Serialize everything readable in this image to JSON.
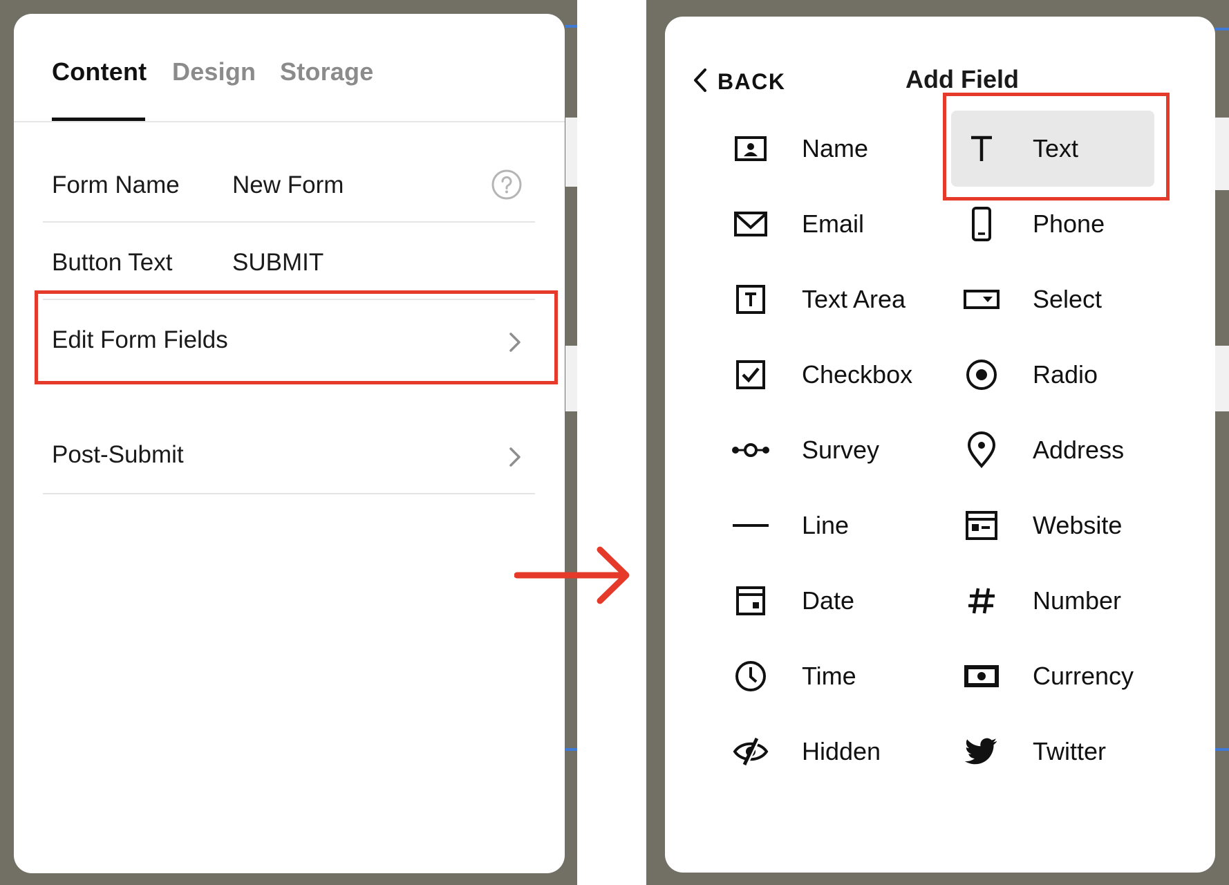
{
  "colors": {
    "olive_background": "#727064",
    "highlight_red": "#e53a2a",
    "arrow_red": "#e53a2a",
    "selected_bg": "#e8e8e8"
  },
  "left_panel": {
    "tabs": [
      {
        "label": "Content",
        "active": true
      },
      {
        "label": "Design",
        "active": false
      },
      {
        "label": "Storage",
        "active": false
      }
    ],
    "form_name": {
      "label": "Form Name",
      "value": "New Form",
      "icon": "help-icon"
    },
    "button_text": {
      "label": "Button Text",
      "value": "SUBMIT"
    },
    "edit_form_fields": {
      "label": "Edit Form Fields",
      "icon": "chevron-right-icon"
    },
    "post_submit": {
      "label": "Post-Submit",
      "icon": "chevron-right-icon"
    }
  },
  "arrow": {
    "icon": "arrow-right-icon"
  },
  "right_panel": {
    "back_label": "BACK",
    "title": "Add Field",
    "fields": [
      {
        "label": "Name",
        "icon": "name-card-icon"
      },
      {
        "label": "Text",
        "icon": "text-t-icon",
        "selected": true
      },
      {
        "label": "Email",
        "icon": "envelope-icon"
      },
      {
        "label": "Phone",
        "icon": "phone-icon"
      },
      {
        "label": "Text Area",
        "icon": "text-area-icon"
      },
      {
        "label": "Select",
        "icon": "select-dropdown-icon"
      },
      {
        "label": "Checkbox",
        "icon": "checkbox-icon"
      },
      {
        "label": "Radio",
        "icon": "radio-icon"
      },
      {
        "label": "Survey",
        "icon": "survey-dots-icon"
      },
      {
        "label": "Address",
        "icon": "map-pin-icon"
      },
      {
        "label": "Line",
        "icon": "line-icon"
      },
      {
        "label": "Website",
        "icon": "website-icon"
      },
      {
        "label": "Date",
        "icon": "calendar-icon"
      },
      {
        "label": "Number",
        "icon": "hash-icon"
      },
      {
        "label": "Time",
        "icon": "clock-icon"
      },
      {
        "label": "Currency",
        "icon": "currency-icon"
      },
      {
        "label": "Hidden",
        "icon": "eye-off-icon"
      },
      {
        "label": "Twitter",
        "icon": "twitter-bird-icon"
      }
    ]
  }
}
